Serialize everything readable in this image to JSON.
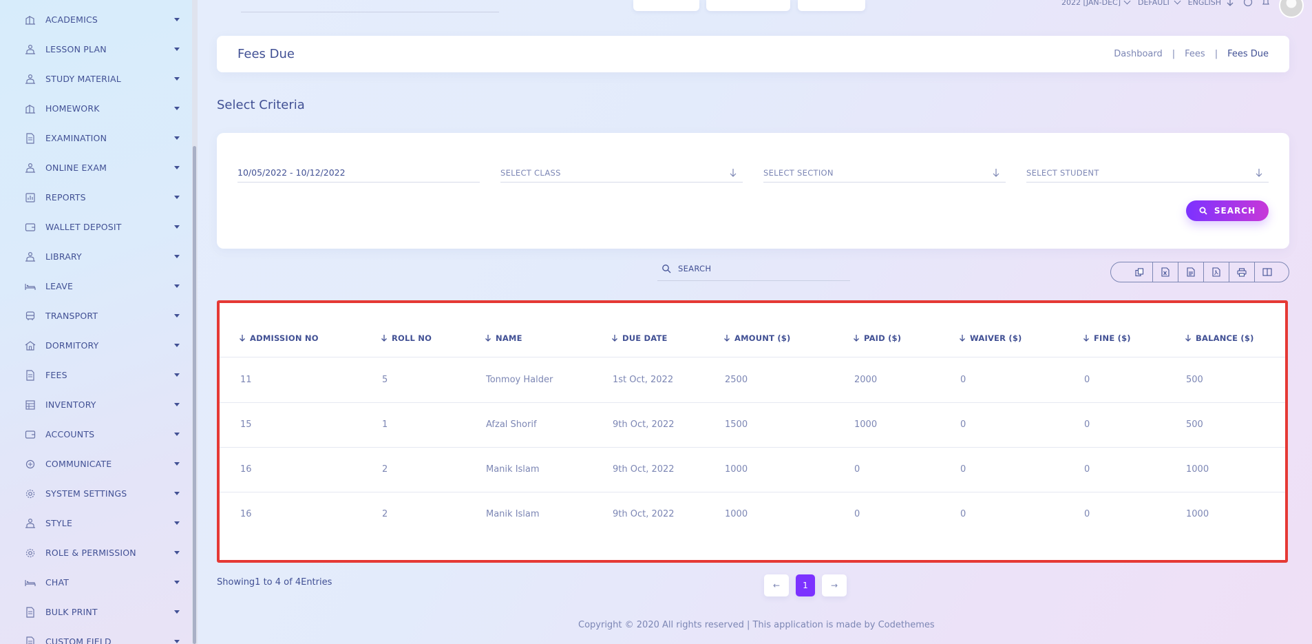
{
  "sidebar": {
    "items": [
      {
        "label": "ACADEMICS",
        "icon": "building-icon"
      },
      {
        "label": "LESSON PLAN",
        "icon": "person-desk-icon"
      },
      {
        "label": "STUDY MATERIAL",
        "icon": "person-desk-icon"
      },
      {
        "label": "HOMEWORK",
        "icon": "building-icon"
      },
      {
        "label": "EXAMINATION",
        "icon": "document-icon"
      },
      {
        "label": "ONLINE EXAM",
        "icon": "person-desk-icon"
      },
      {
        "label": "REPORTS",
        "icon": "report-icon"
      },
      {
        "label": "WALLET DEPOSIT",
        "icon": "wallet-icon"
      },
      {
        "label": "LIBRARY",
        "icon": "person-desk-icon"
      },
      {
        "label": "LEAVE",
        "icon": "bed-icon"
      },
      {
        "label": "TRANSPORT",
        "icon": "bus-icon"
      },
      {
        "label": "DORMITORY",
        "icon": "dorm-icon"
      },
      {
        "label": "FEES",
        "icon": "document-icon"
      },
      {
        "label": "INVENTORY",
        "icon": "inventory-icon"
      },
      {
        "label": "ACCOUNTS",
        "icon": "wallet-icon"
      },
      {
        "label": "COMMUNICATE",
        "icon": "communicate-icon"
      },
      {
        "label": "SYSTEM SETTINGS",
        "icon": "gear-icon"
      },
      {
        "label": "STYLE",
        "icon": "person-desk-icon"
      },
      {
        "label": "ROLE & PERMISSION",
        "icon": "gear-icon"
      },
      {
        "label": "CHAT",
        "icon": "bed-icon"
      },
      {
        "label": "BULK PRINT",
        "icon": "document-icon"
      },
      {
        "label": "CUSTOM FIELD",
        "icon": "document-icon"
      }
    ]
  },
  "topbar": {
    "session": "2022 [JAN-DEC]",
    "theme": "DEFAULT",
    "language": "ENGLISH"
  },
  "header": {
    "title": "Fees Due",
    "breadcrumb": [
      "Dashboard",
      "Fees",
      "Fees Due"
    ]
  },
  "criteria": {
    "title": "Select Criteria",
    "date_range": "10/05/2022 - 10/12/2022",
    "class_placeholder": "SELECT CLASS",
    "section_placeholder": "SELECT SECTION",
    "student_placeholder": "SELECT STUDENT",
    "search_label": "SEARCH"
  },
  "table_tools": {
    "search_placeholder": "SEARCH",
    "export_buttons": [
      "copy-icon",
      "excel-icon",
      "csv-icon",
      "pdf-icon",
      "print-icon",
      "columns-icon"
    ]
  },
  "table": {
    "columns": [
      "ADMISSION NO",
      "ROLL NO",
      "NAME",
      "DUE DATE",
      "AMOUNT ($)",
      "PAID ($)",
      "WAIVER ($)",
      "FINE ($)",
      "BALANCE ($)"
    ],
    "rows": [
      [
        "11",
        "5",
        "Tonmoy Halder",
        "1st Oct, 2022",
        "2500",
        "2000",
        "0",
        "0",
        "500"
      ],
      [
        "15",
        "1",
        "Afzal Shorif",
        "9th Oct, 2022",
        "1500",
        "1000",
        "0",
        "0",
        "500"
      ],
      [
        "16",
        "2",
        "Manik Islam",
        "9th Oct, 2022",
        "1000",
        "0",
        "0",
        "0",
        "1000"
      ],
      [
        "16",
        "2",
        "Manik Islam",
        "9th Oct, 2022",
        "1000",
        "0",
        "0",
        "0",
        "1000"
      ]
    ]
  },
  "pagination": {
    "info": "Showing1 to 4 of 4Entries",
    "prev": "←",
    "current": "1",
    "next": "→"
  },
  "footer": {
    "copyright": "Copyright © 2020 All rights reserved | This application is made by Codethemes"
  },
  "colors": {
    "primary_text": "#415094",
    "accent_start": "#7c32ff",
    "accent_end": "#c738d8",
    "highlight_border": "#e53935"
  }
}
